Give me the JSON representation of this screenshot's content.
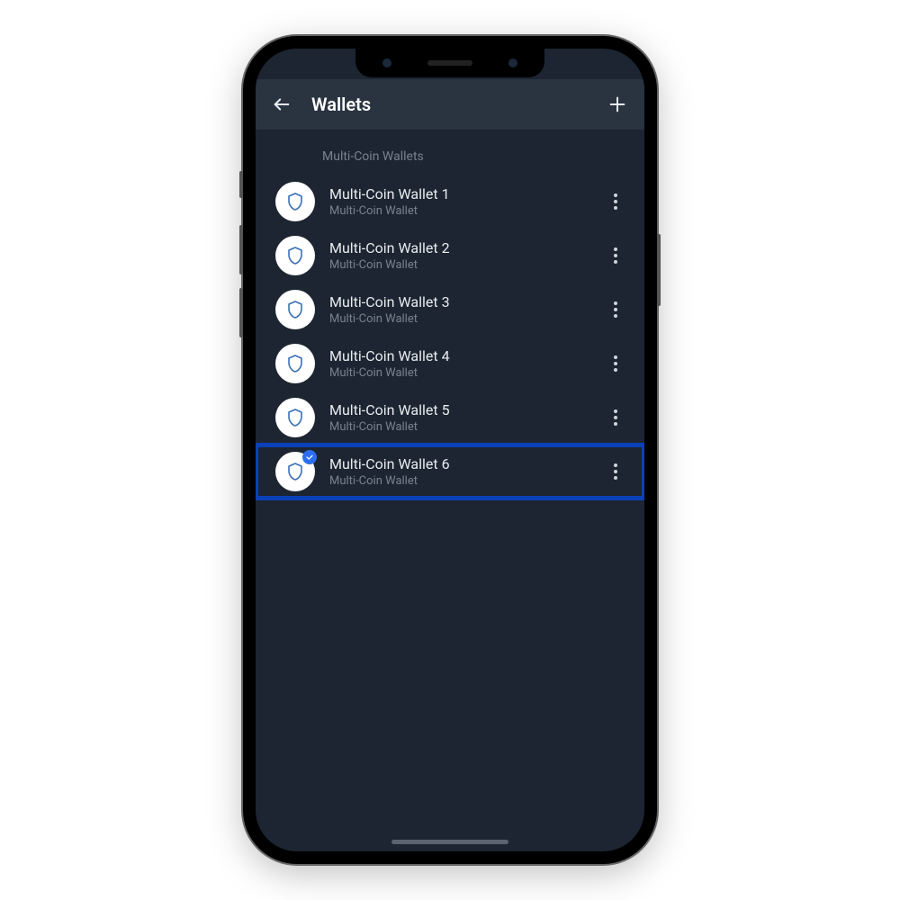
{
  "appbar": {
    "title": "Wallets"
  },
  "section_header": "Multi-Coin Wallets",
  "wallets": [
    {
      "name": "Multi-Coin Wallet 1",
      "subtitle": "Multi-Coin Wallet",
      "selected": false,
      "highlighted": false
    },
    {
      "name": "Multi-Coin Wallet 2",
      "subtitle": "Multi-Coin Wallet",
      "selected": false,
      "highlighted": false
    },
    {
      "name": "Multi-Coin Wallet 3",
      "subtitle": "Multi-Coin Wallet",
      "selected": false,
      "highlighted": false
    },
    {
      "name": "Multi-Coin Wallet 4",
      "subtitle": "Multi-Coin Wallet",
      "selected": false,
      "highlighted": false
    },
    {
      "name": "Multi-Coin Wallet 5",
      "subtitle": "Multi-Coin Wallet",
      "selected": false,
      "highlighted": false
    },
    {
      "name": "Multi-Coin Wallet 6",
      "subtitle": "Multi-Coin Wallet",
      "selected": true,
      "highlighted": true
    }
  ],
  "colors": {
    "bg": "#1c2531",
    "appbar": "#2a3340",
    "text_primary": "#e9ecef",
    "text_secondary": "#79828f",
    "highlight": "#0b41b8",
    "badge": "#2b6ef0"
  }
}
